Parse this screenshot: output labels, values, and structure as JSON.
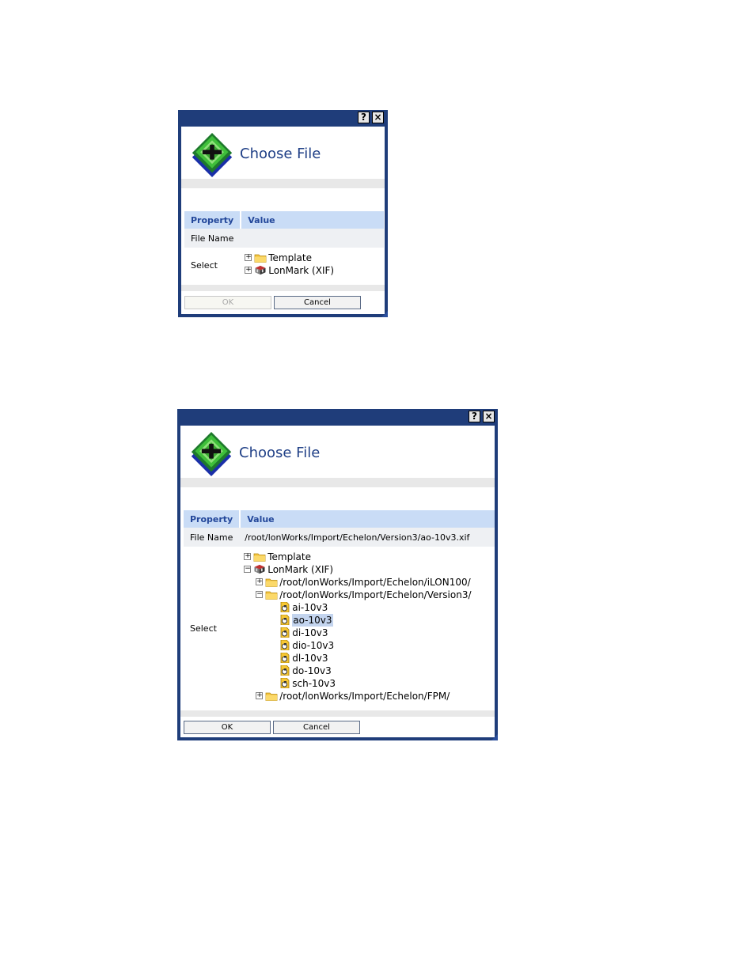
{
  "dialog1": {
    "help_label": "?",
    "close_label": "×",
    "title": "Choose File",
    "table": {
      "col_property": "Property",
      "col_value": "Value"
    },
    "rows": {
      "file_name_label": "File Name",
      "file_name_value": "",
      "select_label": "Select"
    },
    "tree": [
      {
        "label": "Template",
        "icon": "folder-icon",
        "expander": "+"
      },
      {
        "label": "LonMark (XIF)",
        "icon": "lonmark-cube-icon",
        "expander": "+"
      }
    ],
    "ok_label": "OK",
    "cancel_label": "Cancel",
    "ok_enabled": false
  },
  "dialog2": {
    "help_label": "?",
    "close_label": "×",
    "title": "Choose File",
    "table": {
      "col_property": "Property",
      "col_value": "Value"
    },
    "rows": {
      "file_name_label": "File Name",
      "file_name_value": "/root/lonWorks/Import/Echelon/Version3/ao-10v3.xif",
      "select_label": "Select"
    },
    "tree": [
      {
        "label": "Template",
        "icon": "folder-icon",
        "expander": "+"
      },
      {
        "label": "LonMark (XIF)",
        "icon": "lonmark-cube-icon",
        "expander": "−"
      },
      {
        "label": "/root/lonWorks/Import/Echelon/iLON100/",
        "icon": "folder-icon",
        "expander": "+"
      },
      {
        "label": "/root/lonWorks/Import/Echelon/Version3/",
        "icon": "folder-icon",
        "expander": "−"
      },
      {
        "label": "ai-10v3",
        "icon": "xif-file-icon"
      },
      {
        "label": "ao-10v3",
        "icon": "xif-file-icon",
        "selected": true
      },
      {
        "label": "di-10v3",
        "icon": "xif-file-icon"
      },
      {
        "label": "dio-10v3",
        "icon": "xif-file-icon"
      },
      {
        "label": "dl-10v3",
        "icon": "xif-file-icon"
      },
      {
        "label": "do-10v3",
        "icon": "xif-file-icon"
      },
      {
        "label": "sch-10v3",
        "icon": "xif-file-icon"
      },
      {
        "label": "/root/lonWorks/Import/Echelon/FPM/",
        "icon": "folder-icon",
        "expander": "+"
      }
    ],
    "ok_label": "OK",
    "cancel_label": "Cancel",
    "ok_enabled": true
  },
  "colors": {
    "title_bar": "#1f3d7a",
    "title_text": "#1f3f86",
    "header_cell": "#c9dcf6",
    "selection": "#c3d4ee",
    "band": "#e8e8e8"
  }
}
